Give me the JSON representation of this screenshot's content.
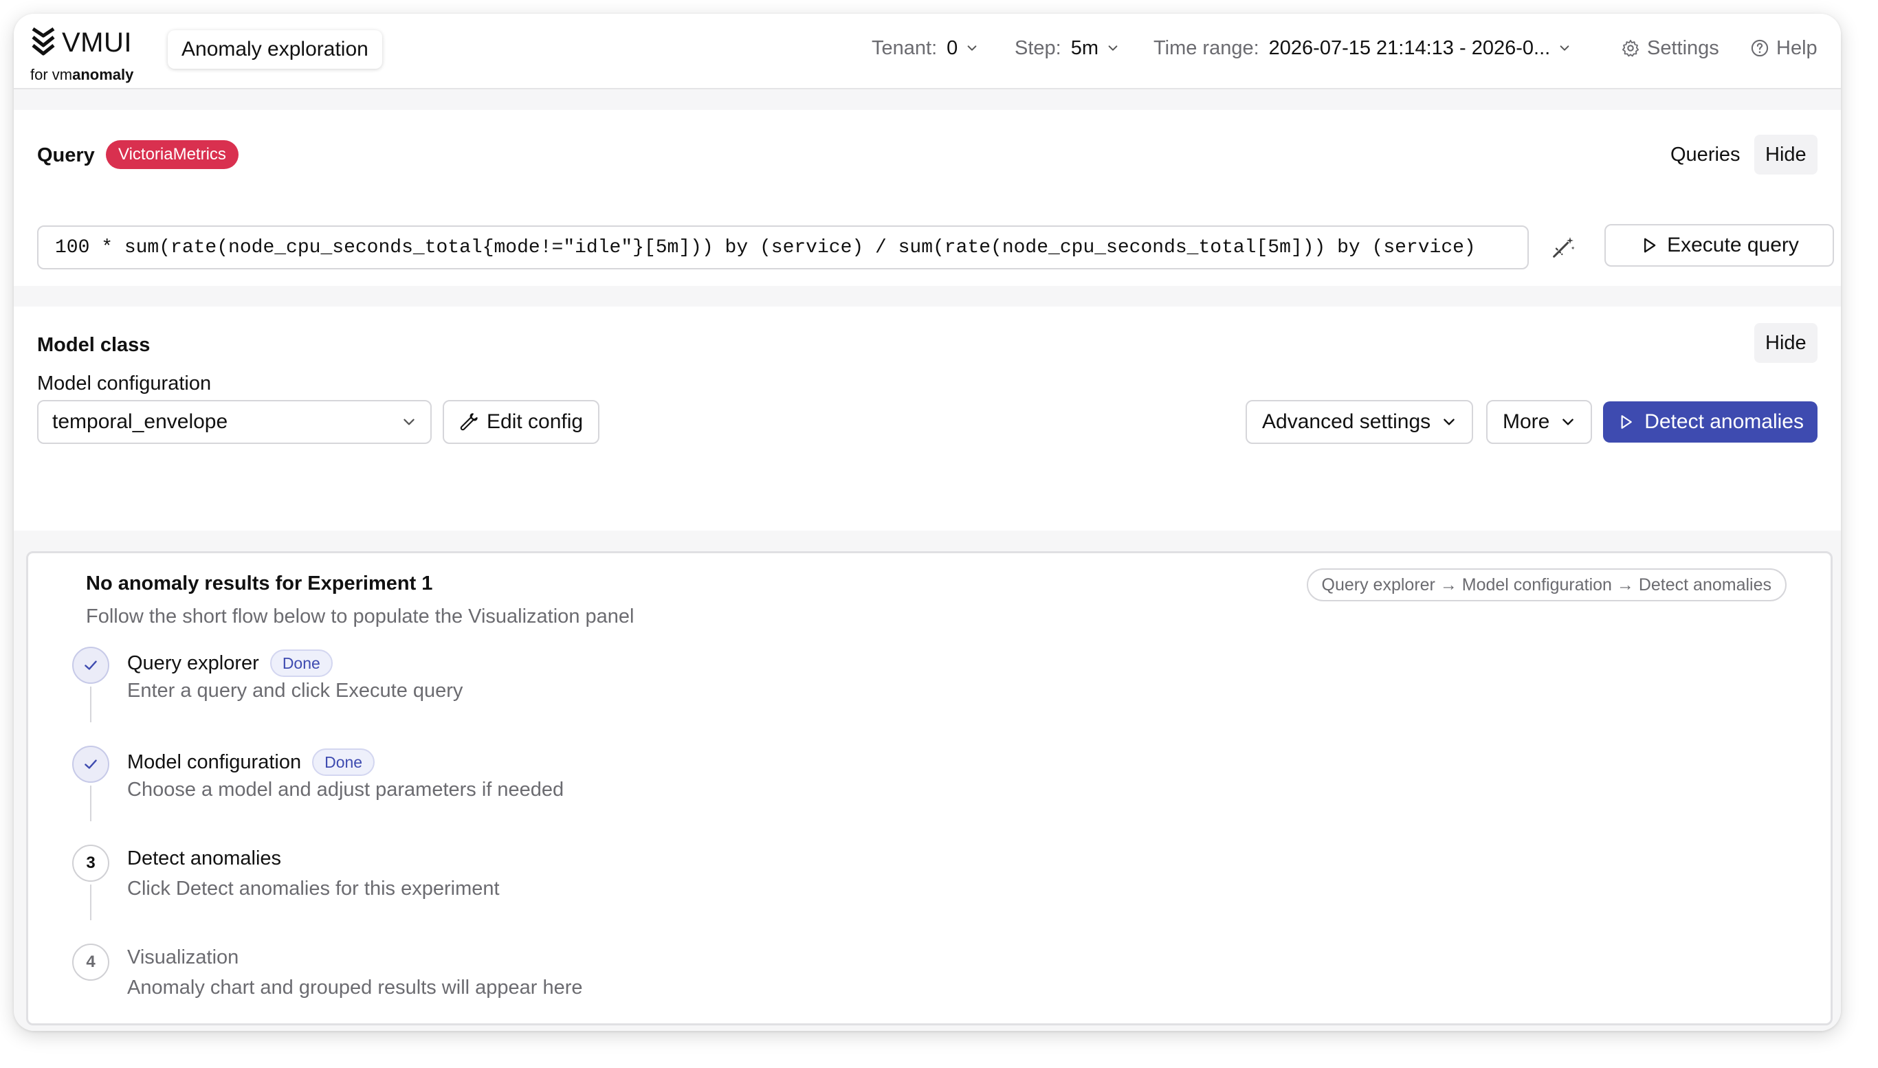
{
  "app": {
    "logo_name": "VMUI",
    "logo_sub_prefix": "for vm",
    "logo_sub_bold": "anomaly",
    "page_title": "Anomaly exploration"
  },
  "header": {
    "tenant_label": "Tenant:",
    "tenant_value": "0",
    "step_label": "Step:",
    "step_value": "5m",
    "time_range_label": "Time range:",
    "time_range_value": "2026-07-15 21:14:13 - 2026-0...",
    "settings_label": "Settings",
    "help_label": "Help"
  },
  "query": {
    "title": "Query",
    "datasource_badge": "VictoriaMetrics",
    "queries_label": "Queries",
    "hide_label": "Hide",
    "expression": "100 * sum(rate(node_cpu_seconds_total{mode!=\"idle\"}[5m])) by (service) / sum(rate(node_cpu_seconds_total[5m])) by (service)",
    "execute_label": "Execute query"
  },
  "model": {
    "title": "Model class",
    "hide_label": "Hide",
    "config_label": "Model configuration",
    "config_value": "temporal_envelope",
    "edit_config_label": "Edit config",
    "advanced_label": "Advanced settings",
    "more_label": "More",
    "detect_label": "Detect anomalies"
  },
  "results": {
    "title": "No anomaly results for Experiment 1",
    "subtitle": "Follow the short flow below to populate the Visualization panel",
    "flow_hint": "Query explorer → Model configuration → Detect anomalies",
    "steps": [
      {
        "marker": "",
        "title": "Query explorer",
        "badge": "Done",
        "desc": "Enter a query and click Execute query"
      },
      {
        "marker": "",
        "title": "Model configuration",
        "badge": "Done",
        "desc": "Choose a model and adjust parameters if needed"
      },
      {
        "marker": "3",
        "title": "Detect anomalies",
        "badge": "",
        "desc": "Click Detect anomalies for this experiment"
      },
      {
        "marker": "4",
        "title": "Visualization",
        "badge": "",
        "desc": "Anomaly chart and grouped results will appear here"
      }
    ]
  },
  "colors": {
    "accent": "#3e4bb0",
    "datasource_badge": "#d9304f",
    "muted_text": "#6b6b70"
  }
}
